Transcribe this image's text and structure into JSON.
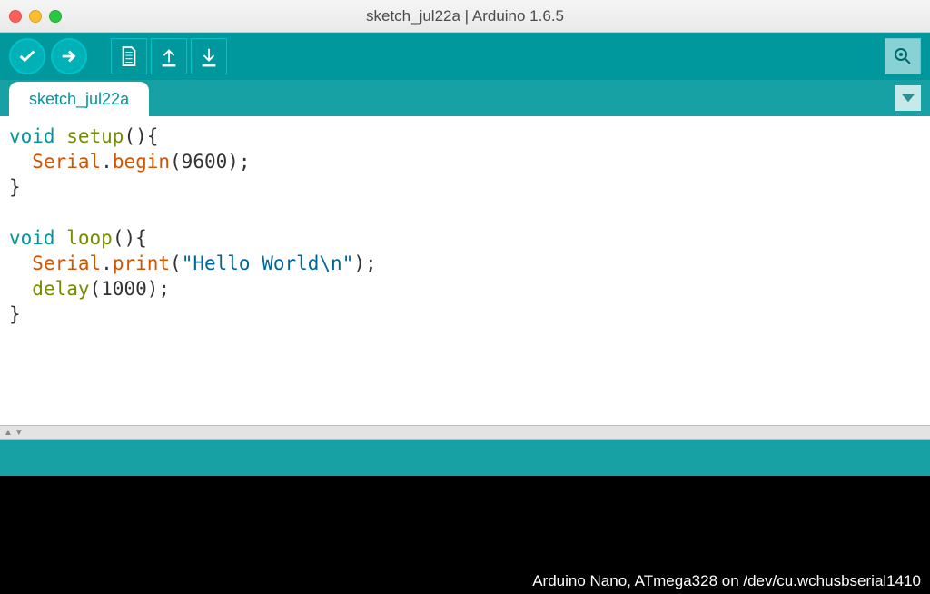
{
  "window": {
    "title": "sketch_jul22a | Arduino 1.6.5"
  },
  "tab": {
    "label": "sketch_jul22a"
  },
  "code": {
    "l1_void": "void",
    "l1_setup": "setup",
    "l1_tail": "(){",
    "l2_indent": "  ",
    "l2_serial": "Serial",
    "l2_dot": ".",
    "l2_begin": "begin",
    "l2_tail": "(9600);",
    "l3": "}",
    "l4": "",
    "l5_void": "void",
    "l5_loop": "loop",
    "l5_tail": "(){",
    "l6_indent": "  ",
    "l6_serial": "Serial",
    "l6_dot": ".",
    "l6_print": "print",
    "l6_open": "(",
    "l6_str": "\"Hello World\\n\"",
    "l6_close": ");",
    "l7_indent": "  ",
    "l7_delay": "delay",
    "l7_tail": "(1000);",
    "l8": "}"
  },
  "status": {
    "board": "Arduino Nano, ATmega328 on /dev/cu.wchusbserial1410"
  }
}
